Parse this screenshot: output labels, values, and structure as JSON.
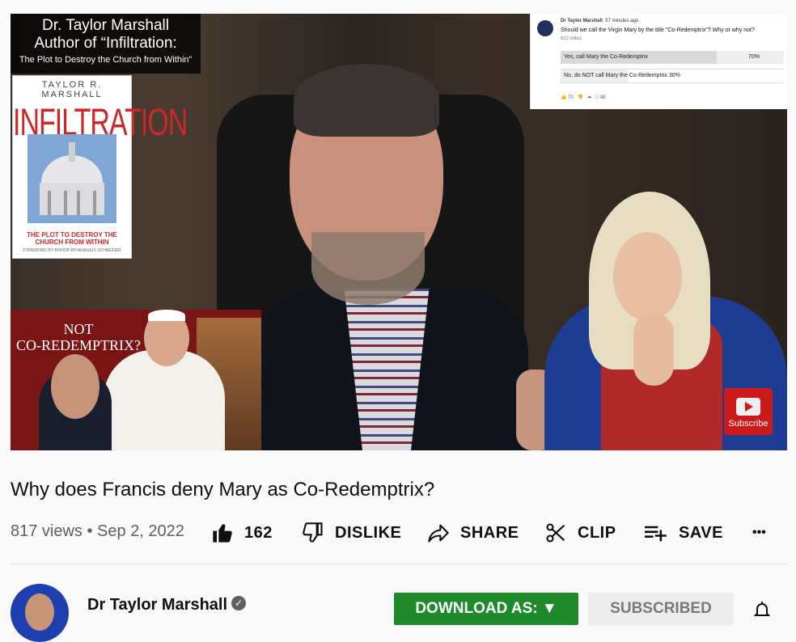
{
  "player": {
    "promo_line1": "Dr. Taylor Marshall",
    "promo_line2": "Author of “Infiltration:",
    "promo_line3": "The Plot to Destroy the Church from Within”",
    "book_author": "TAYLOR R. MARSHALL",
    "book_title": "INFILTRATION",
    "book_subtitle": "THE PLOT TO DESTROY THE CHURCH FROM WITHIN",
    "book_foreword": "FOREWORD BY BISHOP ATHANASIUS SCHNEIDER",
    "pope_caption_1": "NOT",
    "pope_caption_2": "CO-REDEMPTRIX?",
    "subscribe_watermark": "Subscribe"
  },
  "poll": {
    "author": "Dr Taylor Marshall",
    "time": "57 minutes ago",
    "question": "Should we call the Virgin Mary by the title \"Co-Redemptrix\"? Why or why not?",
    "votes": "622 votes",
    "options": [
      {
        "label": "Yes, call Mary the Co-Redemptrix",
        "percent": "70%",
        "value": 0.7
      },
      {
        "label": "No, do NOT call Mary the Co-Redemptrix",
        "percent": "30%",
        "value": 0.3
      }
    ],
    "likes": "70",
    "comments": "48"
  },
  "video": {
    "title": "Why does Francis deny Mary as Co-Redemptrix?",
    "meta": "817 views • Sep 2, 2022"
  },
  "actions": {
    "like_count": "162",
    "dislike": "DISLIKE",
    "share": "SHARE",
    "clip": "CLIP",
    "save": "SAVE",
    "more": "•••"
  },
  "channel": {
    "name": "Dr Taylor Marshall",
    "verified": "✓",
    "download": "DOWNLOAD AS: ▼",
    "subscribed": "SUBSCRIBED"
  },
  "colors": {
    "download_green": "#1e8a2c",
    "brand_red": "#cc1a1a"
  }
}
